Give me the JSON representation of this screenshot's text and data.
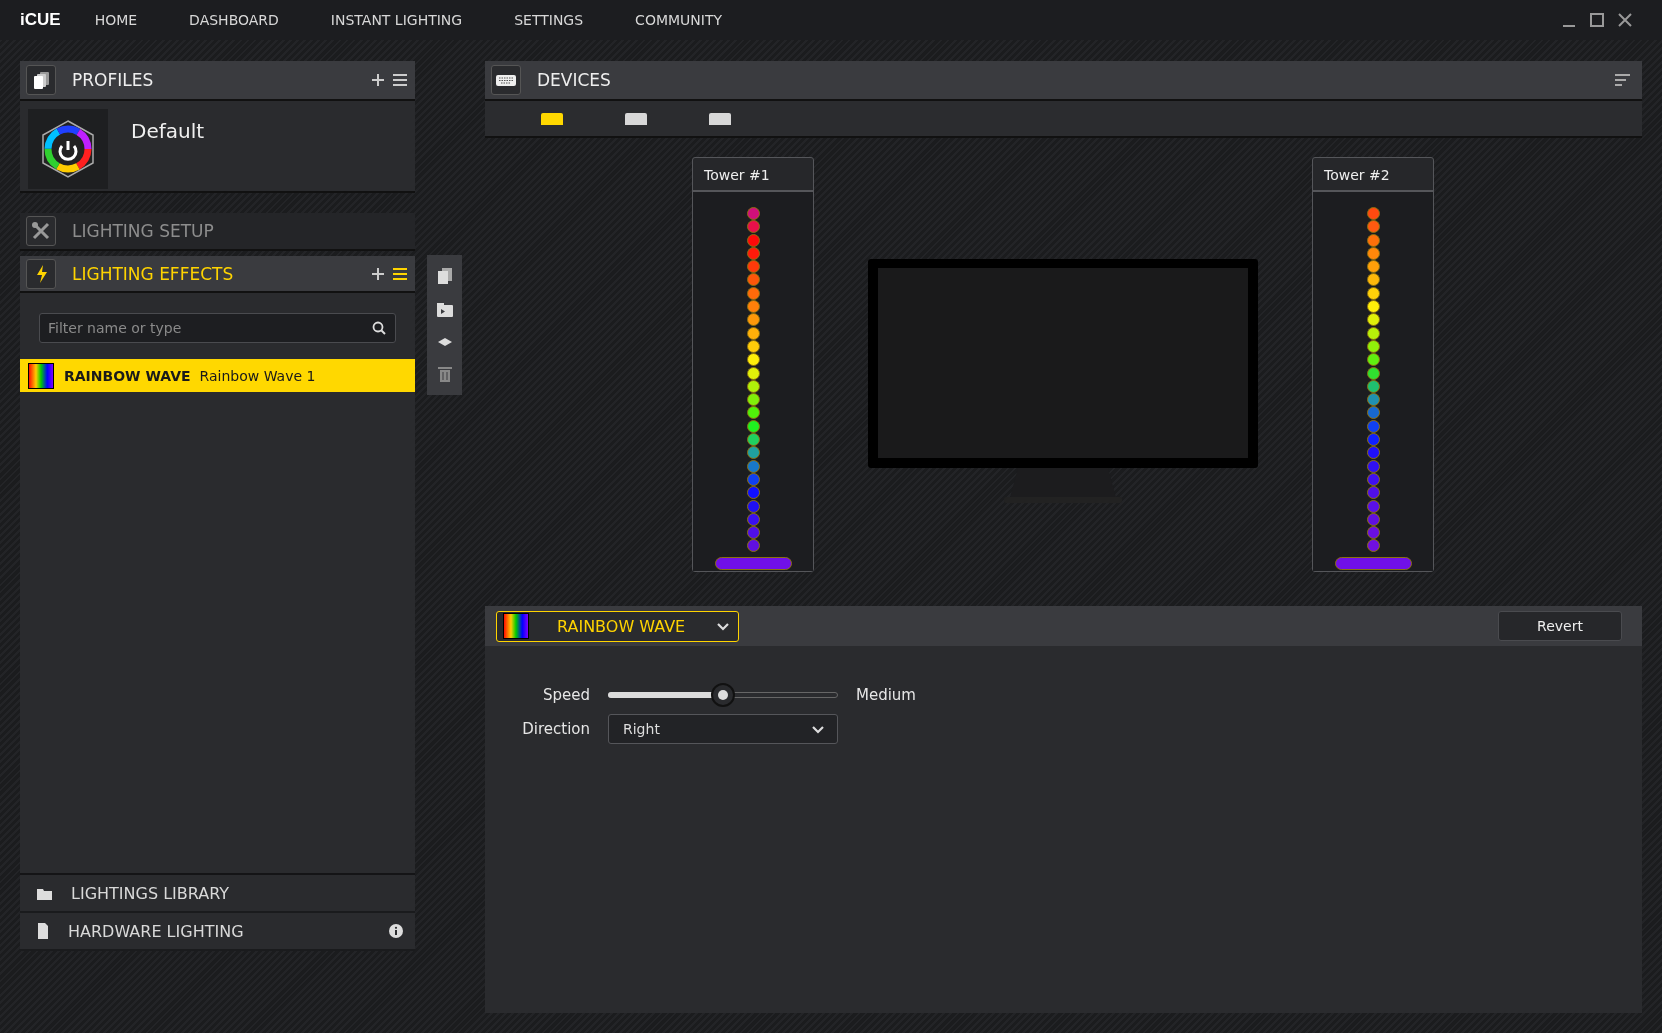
{
  "app_logo": "iCUE",
  "nav": [
    {
      "label": "HOME"
    },
    {
      "label": "DASHBOARD"
    },
    {
      "label": "INSTANT LIGHTING"
    },
    {
      "label": "SETTINGS"
    },
    {
      "label": "COMMUNITY"
    }
  ],
  "profiles": {
    "title": "PROFILES",
    "items": [
      {
        "name": "Default"
      }
    ]
  },
  "lighting_setup": {
    "title": "LIGHTING SETUP"
  },
  "lighting_effects": {
    "title": "LIGHTING EFFECTS",
    "filter": {
      "placeholder": "Filter name or type"
    },
    "items": [
      {
        "type": "RAINBOW WAVE",
        "name": "Rainbow Wave 1",
        "selected": true
      }
    ]
  },
  "bottom_items": [
    {
      "kind": "library",
      "label": "LIGHTINGS LIBRARY"
    },
    {
      "kind": "hardware",
      "label": "HARDWARE LIGHTING"
    }
  ],
  "devices": {
    "title": "DEVICES",
    "tabs": [
      {
        "selected": true
      },
      {
        "selected": false
      },
      {
        "selected": false
      }
    ],
    "towers": [
      {
        "label": "Tower #1",
        "strip": {
          "color": "#7010e8"
        },
        "leds": [
          {
            "color": "#d0107a"
          },
          {
            "color": "#e8104a"
          },
          {
            "color": "#ff0a0a"
          },
          {
            "color": "#ff1a0a"
          },
          {
            "color": "#ff3a0a"
          },
          {
            "color": "#ff560a"
          },
          {
            "color": "#ff6a0a"
          },
          {
            "color": "#ff800a"
          },
          {
            "color": "#ff980a"
          },
          {
            "color": "#ffb00a"
          },
          {
            "color": "#ffcc0a"
          },
          {
            "color": "#ffee0a"
          },
          {
            "color": "#e0f00a"
          },
          {
            "color": "#b0f00a"
          },
          {
            "color": "#80f00a"
          },
          {
            "color": "#50f00a"
          },
          {
            "color": "#20f020"
          },
          {
            "color": "#20d060"
          },
          {
            "color": "#20a0a0"
          },
          {
            "color": "#1878c8"
          },
          {
            "color": "#1040f0"
          },
          {
            "color": "#1010ff"
          },
          {
            "color": "#2010f0"
          },
          {
            "color": "#3a10f0"
          },
          {
            "color": "#5010e8"
          },
          {
            "color": "#6010e0"
          }
        ]
      },
      {
        "label": "Tower #2",
        "strip": {
          "color": "#7010e8"
        },
        "leds": [
          {
            "color": "#ff4a10"
          },
          {
            "color": "#ff5a10"
          },
          {
            "color": "#ff700a"
          },
          {
            "color": "#ff880a"
          },
          {
            "color": "#ffa00a"
          },
          {
            "color": "#ffb80a"
          },
          {
            "color": "#ffd00a"
          },
          {
            "color": "#ffee0a"
          },
          {
            "color": "#e0f00a"
          },
          {
            "color": "#b8f00a"
          },
          {
            "color": "#90f00a"
          },
          {
            "color": "#60f010"
          },
          {
            "color": "#30e030"
          },
          {
            "color": "#20c070"
          },
          {
            "color": "#2090b0"
          },
          {
            "color": "#1868d0"
          },
          {
            "color": "#1040f0"
          },
          {
            "color": "#1020ff"
          },
          {
            "color": "#2010f8"
          },
          {
            "color": "#3010f0"
          },
          {
            "color": "#4010f0"
          },
          {
            "color": "#5010e8"
          },
          {
            "color": "#5a10e8"
          },
          {
            "color": "#6010e0"
          },
          {
            "color": "#6a10e0"
          },
          {
            "color": "#7010e0"
          }
        ]
      }
    ]
  },
  "effect": {
    "name": "RAINBOW WAVE",
    "revert": "Revert",
    "settings": [
      {
        "kind": "slider",
        "label": "Speed",
        "level": 0.5,
        "reading": "Medium"
      },
      {
        "kind": "dropdown",
        "label": "Direction",
        "value": "Right"
      }
    ]
  }
}
